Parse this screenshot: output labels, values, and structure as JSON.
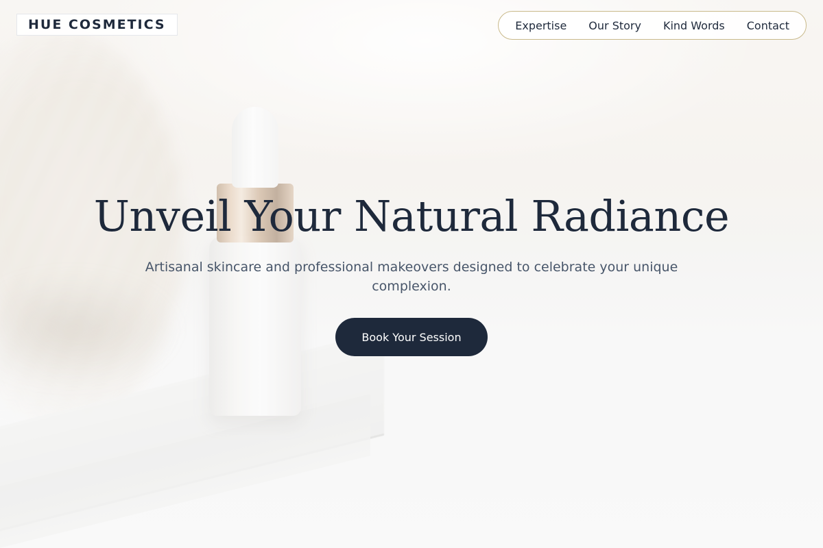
{
  "header": {
    "brand": "HUE COSMETICS",
    "nav": [
      {
        "label": "Expertise"
      },
      {
        "label": "Our Story"
      },
      {
        "label": "Kind Words"
      },
      {
        "label": "Contact"
      }
    ]
  },
  "hero": {
    "title": "Unveil Your Natural Radiance",
    "subtitle": "Artisanal skincare and professional makeovers designed to celebrate your unique complexion.",
    "cta_label": "Book Your Session"
  },
  "colors": {
    "primary": "#1e293b",
    "nav_border": "#c9b98a",
    "subtitle": "#475569",
    "background": "#f4f3f1"
  }
}
